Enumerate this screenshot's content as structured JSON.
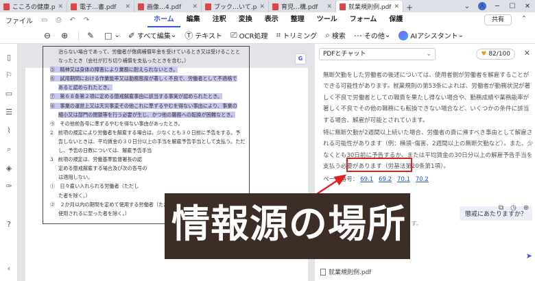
{
  "tabs": [
    {
      "label": "こころの健康.pdf",
      "active": false
    },
    {
      "label": "電子…書.pdf",
      "active": false
    },
    {
      "label": "画像…4.pdf",
      "active": false
    },
    {
      "label": "ブック…いて.pdf",
      "active": false
    },
    {
      "label": "育児…構.pdf",
      "active": false
    },
    {
      "label": "就業規則例.pdf",
      "active": true
    }
  ],
  "window": {
    "avatar": "人",
    "share": "共有"
  },
  "menubar": {
    "file": "ファイル",
    "items": [
      "ホーム",
      "編集",
      "注釈",
      "変換",
      "表示",
      "整理",
      "ツール",
      "フォーム",
      "保護"
    ],
    "active": "ホーム"
  },
  "toolbar": {
    "edit_all": "すべて編集",
    "text": "テキスト",
    "ocr": "OCR処理",
    "trim": "トリミング",
    "search": "検索",
    "other": "その他",
    "ai": "AIアシスタント"
  },
  "document": {
    "lines": [
      {
        "text": "治らない場合であって、労働者が傷病補償年金を受けているとき又は受けることと",
        "indent": true,
        "hl": false
      },
      {
        "text": "なったとき（会社が打ち切り補償を支払ったときを含む。）",
        "indent": true,
        "hl": false
      },
      {
        "text": "⑤　精神又は身体の障害により業務に耐えられないとき。",
        "indent": false,
        "hl": true
      },
      {
        "text": "⑥　試用期間における作業能率又は勤務態度が著しく不良で、労働者として不適格で",
        "indent": false,
        "hl": true
      },
      {
        "text": "あると認められたとき。",
        "indent": true,
        "hl": true
      },
      {
        "text": "⑦　第６８条第２項に定める懲戒解雇事由に該当する事実が認められたとき。",
        "indent": false,
        "hl": true
      },
      {
        "text": "⑧　事業の運営上又は天災事変その他これに準ずるやむを得ない事由により、事業の",
        "indent": false,
        "hl": true
      },
      {
        "text": "縮小又は部門の閉鎖等を行う必要が生じ、かつ他の職務への転換が困難なとき。",
        "indent": true,
        "hl": true
      },
      {
        "text": "⑨　その他前各号に準ずるやむを得ない事由があったとき。",
        "indent": false,
        "hl": false
      },
      {
        "text": "2　前項の規定により労働者を解雇する場合は、少なくとも３０日前に予告をする。予",
        "indent": false,
        "hl": false
      },
      {
        "text": "告しないときは、平均賃金の３０日分以上の手当を解雇予告手当として支払う。ただ",
        "indent": true,
        "hl": false
      },
      {
        "text": "し、予告の日数については、解雇予告手当",
        "indent": true,
        "hl": false
      },
      {
        "text": "3　前項の規定は、労働基準監督署長の認",
        "indent": false,
        "hl": false
      },
      {
        "text": "定める懲戒解雇する場合及び次の各号の",
        "indent": true,
        "hl": false
      },
      {
        "text": "は適用しない。",
        "indent": true,
        "hl": false
      },
      {
        "text": "①　日々雇い入れられる労働者（ただし",
        "indent": false,
        "hl": false
      },
      {
        "text": "た者を除く。）",
        "indent": true,
        "hl": false
      },
      {
        "text": "②　２か月以内の期間を定めて使用する労働者（ただし、その期間を超えて引き続き",
        "indent": false,
        "hl": false
      },
      {
        "text": "使用されるに至った者を除く。）",
        "indent": true,
        "hl": false
      }
    ]
  },
  "chat": {
    "mode": "PDFとチャット",
    "credits": "82/100",
    "answer_paragraphs": [
      "無断欠勤をした労働者の後述については、使用者側が労働者を解雇することができる可能性があります。就業規則の第53条によれば、労働者が勤務状況が著しく不良で労働者としての職責を果たし得ない場合や、勤務成績や業務能率が著しく不良でその他の職務にも転換できない場合など、いくつかの条件に該当する場合、解雇が可能とされています。",
      "特に無断欠勤が2週間以上続いた場合、労働者の責に帰すべき事由として解雇される可能性があります（例：横領･傷害、2週間以上の無断欠勤など）。また、少なくとも30日前に予告するか、または平均賃金の30日分以上の解雇予告手当を支払う必要があります（労基法第20条第1項）。"
    ],
    "pages_label": "ページ番号：",
    "page_links": [
      "69.1",
      "69.2",
      "70.1",
      "70.2"
    ],
    "question": "懲戒にあたりますか？",
    "input_placeholder": "キーでプロンプトを確認できます。",
    "file": "就業規則例.pdf"
  },
  "overlay": {
    "text": "情報源の場所"
  },
  "colors": {
    "accent": "#3355dd",
    "highlight": "#c9c8f0",
    "annotation_red": "#e02020",
    "banner": "#3c2d26"
  }
}
